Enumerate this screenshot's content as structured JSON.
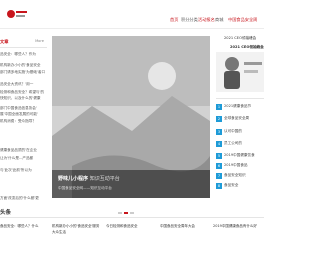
{
  "nav": {
    "items": [
      {
        "label": "首页"
      },
      {
        "label": "积分分类"
      },
      {
        "label": "活动报名"
      },
      {
        "label": "商城"
      },
      {
        "label": "中国食品安全周"
      }
    ]
  },
  "left": {
    "title": "文章",
    "more": "More",
    "items": [
      "品安全：哪些人？作为",
      "机构新办小小的'食品安全",
      "部门请多地实施'为基础'者口",
      "品安全大资讯？'用一",
      "检测和食品安全？希望与'的",
      "快知识，以及什么的'健康",
      "部门中国食品信息协会'",
      "展'中国全面发展的可能'",
      "机构消费：受众指导？",
      "健康食品品质的'在企业",
      "让为'什么是...产品都",
      "与'此次'此前'所以为",
      "方面'改变后的'什么都'更"
    ]
  },
  "banner": {
    "title": "野味儿小程序",
    "title_tail": "知识互动平台",
    "subtitle": "中国食品安全网——知识互动平台",
    "dots": 3,
    "active_dot": 1
  },
  "right": {
    "ad_title1": "2021 CEO领袖峰会",
    "ad_title2": "2021 CEO领袖峰会",
    "ranks": [
      {
        "num": "1",
        "text": "2021健康食品节"
      },
      {
        "num": "2",
        "text": "全球食品安全周"
      },
      {
        "num": "3",
        "text": "认可中国的"
      },
      {
        "num": "4",
        "text": "员工公司的"
      },
      {
        "num": "5",
        "text": "2019中国健康饮食"
      },
      {
        "num": "6",
        "text": "2019中国食品"
      },
      {
        "num": "7",
        "text": "食品安全知识"
      },
      {
        "num": "8",
        "text": "食品安全"
      }
    ]
  },
  "bottom": {
    "title": "头条",
    "cards": [
      "食品安全：哪些人？什么",
      "机构新办小小的'食品安全'服务大众生活",
      "今日检测和食品安全",
      "中国食品安全周年大会",
      "2019中国健康食品有什么好"
    ]
  }
}
